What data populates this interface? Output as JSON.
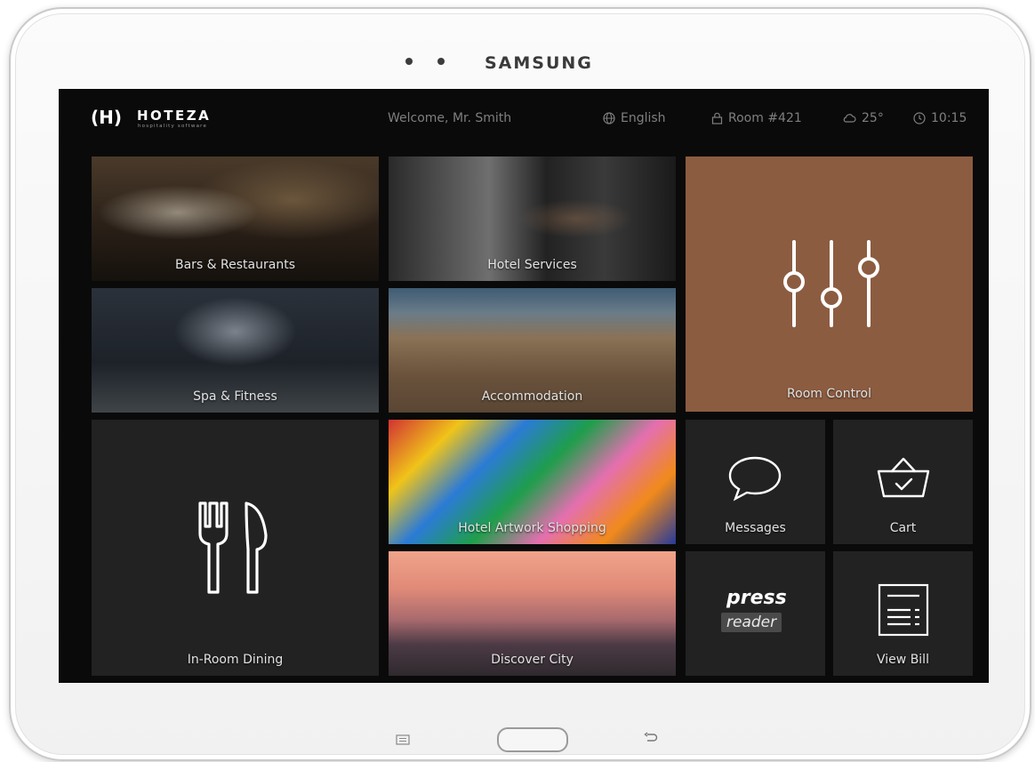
{
  "device": {
    "brand": "SAMSUNG"
  },
  "header": {
    "logo_mark": "(H)",
    "logo_name": "HOTEZA",
    "logo_tagline": "hospitality software",
    "welcome": "Welcome, Mr. Smith",
    "language": "English",
    "room": "Room #421",
    "temperature": "25°",
    "time": "10:15"
  },
  "tiles": {
    "bars_restaurants": "Bars & Restaurants",
    "hotel_services": "Hotel Services",
    "room_control": "Room Control",
    "spa_fitness": "Spa & Fitness",
    "accommodation": "Accommodation",
    "in_room_dining": "In-Room Dining",
    "artwork_shopping": "Hotel Artwork Shopping",
    "messages": "Messages",
    "cart": "Cart",
    "discover_city": "Discover City",
    "pressreader_top": "press",
    "pressreader_bottom": "reader",
    "view_bill": "View Bill"
  },
  "colors": {
    "screen_bg": "#0a0a0a",
    "tile_dark": "#222222",
    "room_control_accent": "#8c5c40"
  },
  "icons": [
    "globe-icon",
    "lock-icon",
    "cloud-icon",
    "clock-icon",
    "sliders-icon",
    "fork-knife-icon",
    "chat-bubble-icon",
    "basket-icon",
    "bill-icon"
  ]
}
